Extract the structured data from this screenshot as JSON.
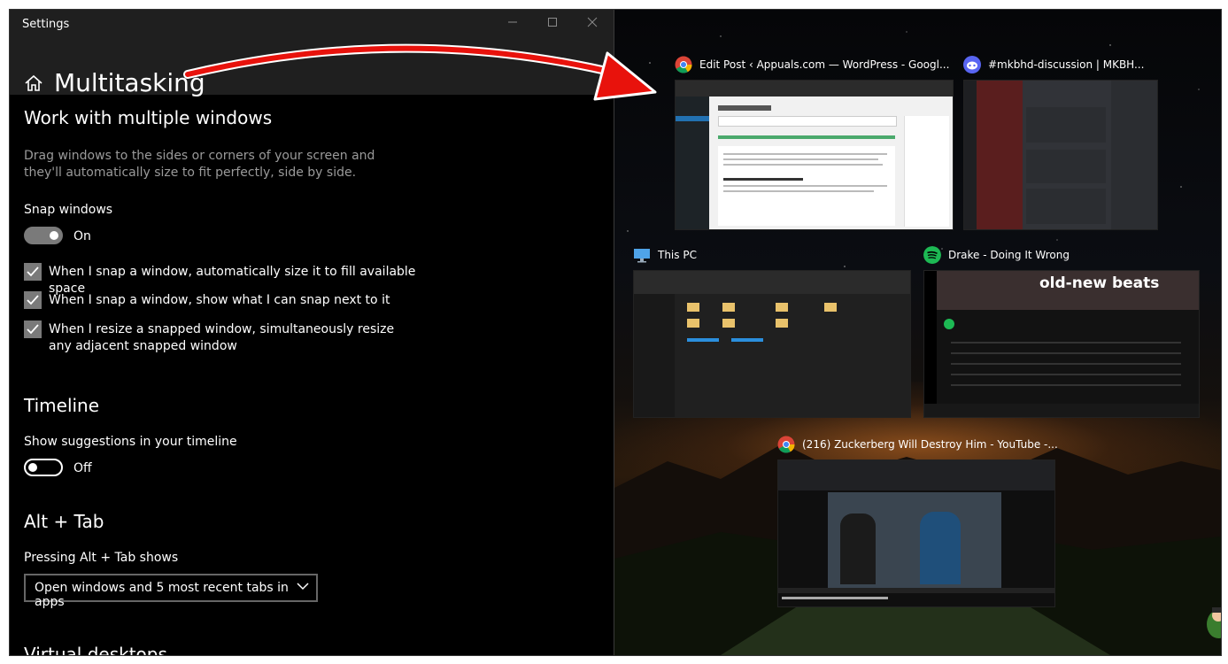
{
  "settings": {
    "app_title": "Settings",
    "page_title": "Multitasking",
    "snap_section": {
      "title": "Work with multiple windows",
      "description": "Drag windows to the sides or corners of your screen and they'll automatically size to fit perfectly, side by side.",
      "snap_label": "Snap windows",
      "snap_state": "On",
      "options": [
        "When I snap a window, automatically size it to fill available space",
        "When I snap a window, show what I can snap next to it",
        "When I resize a snapped window, simultaneously resize any adjacent snapped window"
      ]
    },
    "timeline_section": {
      "title": "Timeline",
      "label": "Show suggestions in your timeline",
      "state": "Off"
    },
    "alttab_section": {
      "title": "Alt + Tab",
      "label": "Pressing Alt + Tab shows",
      "selected": "Open windows and 5 most recent tabs in apps"
    },
    "next_section_partial": "Virtual desktops"
  },
  "taskview": {
    "windows": [
      {
        "title": "Edit Post ‹ Appuals.com — WordPress - Googl...",
        "icon": "chrome-icon"
      },
      {
        "title": "#mkbhd-discussion | MKBH...",
        "icon": "discord-icon"
      },
      {
        "title": "This PC",
        "icon": "this-pc-icon"
      },
      {
        "title": "Drake - Doing It Wrong",
        "icon": "spotify-icon"
      },
      {
        "title": "(216) Zuckerberg Will Destroy Him - YouTube -...",
        "icon": "chrome-icon"
      }
    ],
    "spotify_banner": "old-new beats"
  },
  "colors": {
    "arrow": "#e8120c",
    "settings_bg": "#000000",
    "header_bg": "#1f1f1f",
    "toggle_on": "#7a7a7a",
    "spotify_green": "#1db954",
    "discord_bg": "#313338"
  }
}
